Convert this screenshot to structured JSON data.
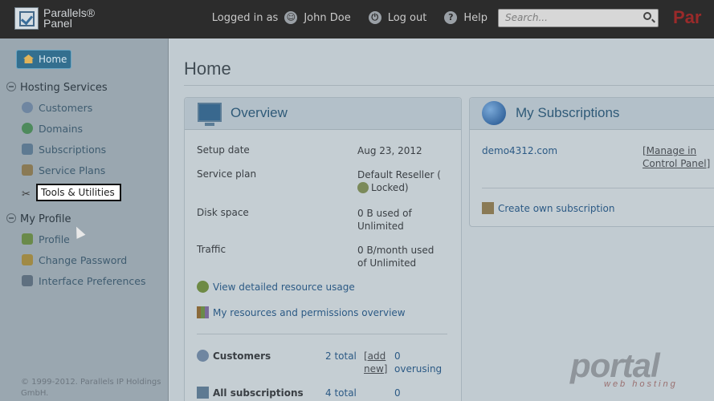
{
  "header": {
    "logo_line1": "Parallels®",
    "logo_line2": "Panel",
    "logged_in_as": "Logged in as",
    "user_name": "John Doe",
    "logout": "Log out",
    "help": "Help",
    "search_placeholder": "Search...",
    "brand": "Par"
  },
  "sidebar": {
    "home": "Home",
    "hosting_services": "Hosting Services",
    "items": [
      "Customers",
      "Domains",
      "Subscriptions",
      "Service Plans",
      "Tools & Utilities"
    ],
    "my_profile": "My Profile",
    "profile_items": [
      "Profile",
      "Change Password",
      "Interface Preferences"
    ],
    "copyright": "© 1999-2012. Parallels IP Holdings GmbH."
  },
  "main": {
    "title": "Home",
    "overview": {
      "title": "Overview",
      "rows": [
        {
          "label": "Setup date",
          "value": "Aug 23, 2012"
        },
        {
          "label": "Service plan",
          "value": "Default Reseller (",
          "value2": "Locked)"
        },
        {
          "label": "Disk space",
          "value": "0 B used of",
          "value2": "Unlimited"
        },
        {
          "label": "Traffic",
          "value": "0 B/month used",
          "value2": "of Unlimited"
        }
      ],
      "link_usage": "View detailed resource usage",
      "link_permissions": "My resources and permissions overview",
      "customers_label": "Customers",
      "customers_total": "2 total",
      "customers_add": "[add",
      "customers_add2": "new]",
      "customers_over": "0",
      "customers_over2": "overusing",
      "subs_label": "All subscriptions",
      "subs_total": "4 total",
      "subs_over": "0"
    },
    "subscriptions": {
      "title": "My Subscriptions",
      "domain": "demo4312.com",
      "manage1": "[Manage in",
      "manage2": "Control Panel]",
      "create": "Create own subscription"
    }
  },
  "watermark": {
    "text": "portal",
    "sub": "web hosting"
  },
  "colors": {
    "topbar": "#2c2c2c",
    "sidebar": "#9aa7b0",
    "accent": "#2c5a85"
  }
}
